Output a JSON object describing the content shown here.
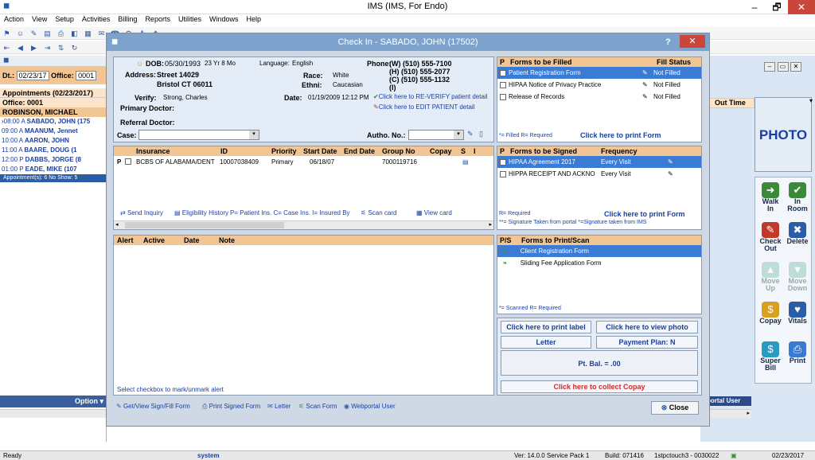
{
  "window": {
    "title": "IMS (IMS, For Endo)",
    "min": "–",
    "max": "🗗",
    "close": "✕"
  },
  "menu": [
    "Action",
    "View",
    "Setup",
    "Activities",
    "Billing",
    "Reports",
    "Utilities",
    "Windows",
    "Help"
  ],
  "left": {
    "dt_label": "Dt.:",
    "date": "02/23/17",
    "office_label": "Office:",
    "office_val": "0001",
    "header": "Appointments (02/23/2017)",
    "office": "Office: 0001",
    "patient": "ROBINSON, MICHAEL",
    "rows": [
      {
        "time": "08:00 A",
        "name": "SABADO, JOHN (175"
      },
      {
        "time": "09:00 A",
        "name": "MAANUM, Jennet"
      },
      {
        "time": "10:00 A",
        "name": "AARON, JOHN"
      },
      {
        "time": "11:00 A",
        "name": "BAARE, DOUG (1"
      },
      {
        "time": "12:00 P",
        "name": "DABBS, JORGE (8"
      },
      {
        "time": "01:00 P",
        "name": "EADE, MIKE (107"
      }
    ],
    "summary": "Appointment(s): 6   No Show: 5",
    "option": "Option"
  },
  "right": {
    "col1": "e",
    "col2": "Out Time",
    "photo": "PHOTO",
    "bottom": "portal User",
    "buttons": [
      {
        "label1": "Walk",
        "label2": "In",
        "icon": "walk-in-icon",
        "color": "#3a8a3a",
        "glyph": "➜",
        "dis": false
      },
      {
        "label1": "In",
        "label2": "Room",
        "icon": "in-room-icon",
        "color": "#3a8a3a",
        "glyph": "✔",
        "dis": false
      },
      {
        "label1": "Check",
        "label2": "Out",
        "icon": "check-out-icon",
        "color": "#c03a2a",
        "glyph": "✎",
        "dis": false
      },
      {
        "label1": "Delete",
        "label2": "",
        "icon": "delete-icon",
        "color": "#2a5ca8",
        "glyph": "✖",
        "dis": false
      },
      {
        "label1": "Move",
        "label2": "Up",
        "icon": "move-up-icon",
        "color": "#7fc0b0",
        "glyph": "▲",
        "dis": true
      },
      {
        "label1": "Move",
        "label2": "Down",
        "icon": "move-down-icon",
        "color": "#7fc0b0",
        "glyph": "▼",
        "dis": true
      },
      {
        "label1": "Copay",
        "label2": "",
        "icon": "copay-icon",
        "color": "#d8a020",
        "glyph": "$",
        "dis": false
      },
      {
        "label1": "Vitals",
        "label2": "",
        "icon": "vitals-icon",
        "color": "#2a5ca8",
        "glyph": "♥",
        "dis": false
      },
      {
        "label1": "Super",
        "label2": "Bill",
        "icon": "super-bill-icon",
        "color": "#2a9ac0",
        "glyph": "$",
        "dis": false
      },
      {
        "label1": "Print",
        "label2": "",
        "icon": "print-icon",
        "color": "#3a7ad5",
        "glyph": "⎙",
        "dis": false
      }
    ]
  },
  "dialog": {
    "title": "Check In - SABADO, JOHN  (17502)",
    "help": "?",
    "close": "✕",
    "dob_label": "DOB:",
    "dob": "05/30/1993",
    "age": "23 Yr 8 Mo",
    "lang_label": "Language:",
    "lang": "English",
    "phone_label": "Phone:",
    "phones": [
      "(W)  (510) 555-7100",
      "(H)  (510) 555-2077",
      "(C)  (510) 555-1132",
      "(I)"
    ],
    "addr_label": "Address:",
    "addr1": "Street 14029",
    "addr2": "Bristol  CT  06011",
    "race_label": "Race:",
    "race": "White",
    "eth_label": "Ethni:",
    "eth": "Caucasian",
    "verify_label": "Verify:",
    "verify": "Strong, Charles",
    "date_label": "Date:",
    "date": "01/19/2009 12:12 PM",
    "reverify": "Click here to RE-VERIFY patient detail",
    "edit": "Click here to EDIT PATIENT detail",
    "primary_doc": "Primary Doctor:",
    "referral_doc": "Referral Doctor:",
    "case": "Case:",
    "autho": "Autho. No.:",
    "ins_headers": [
      "Insurance",
      "ID",
      "Priority",
      "Start Date",
      "End Date",
      "Group No",
      "Copay",
      "S",
      "I"
    ],
    "ins_row": {
      "p": "P",
      "ins": "BCBS OF ALABAMA/DENT",
      "id": "10007038409",
      "priority": "Primary",
      "start": "06/18/07",
      "end": "",
      "group": "7000119716"
    },
    "ins_links": [
      "Send Inquiry",
      "Eligibility History",
      "P= Patient Ins. C= Case Ins. I= Insured By",
      "Scan card",
      "View card"
    ],
    "alert_headers": [
      "Alert",
      "Active",
      "Date",
      "Note"
    ],
    "alert_hint": "Select checkbox to mark/unmark alert",
    "fill": {
      "h1": "P",
      "h2": "Forms to be Filled",
      "h3": "Fill Status",
      "rows": [
        {
          "name": "Patient Registration Form",
          "status": "Not Filled"
        },
        {
          "name": "HIPAA Notice of Privacy Practice",
          "status": "Not Filled"
        },
        {
          "name": "Release of Records",
          "status": "Not Filled"
        }
      ],
      "legend": "*= Filled   R= Required",
      "print": "Click here to print Form"
    },
    "sign": {
      "h1": "P",
      "h2": "Forms to be Signed",
      "h3": "Frequency",
      "rows": [
        {
          "name": "HIPAA Agreement 2017",
          "freq": "Every Visit"
        },
        {
          "name": "HIPPA RECEIPT AND ACKNO",
          "freq": "Every Visit"
        }
      ],
      "legend1": "R= Required",
      "legend2": "**= Signature Taken from portal  *=Signature taken from IMS",
      "print": "Click here to print Form"
    },
    "scan": {
      "h1": "P/S",
      "h2": "Forms to Print/Scan",
      "rows": [
        "Client Registration Form",
        "Sliding Fee Application Form"
      ],
      "legend": "*= Scanned   R= Required"
    },
    "btns": {
      "print_label": "Click here to print label",
      "view_photo": "Click here to view photo",
      "letter": "Letter",
      "payment": "Payment Plan: N",
      "bal": "Pt. Bal. = .00",
      "collect": "Click here to collect Copay"
    },
    "bottom": [
      "Get/View Sign/Fill Form",
      "Print Signed Form",
      "Letter",
      "Scan Form",
      "Webportal User"
    ],
    "close_btn": "Close"
  },
  "status": {
    "ready": "Ready",
    "user": "system",
    "ver": "Ver: 14.0.0 Service Pack 1",
    "build": "Build: 071416",
    "host": "1stpctouch3 - 0030022",
    "date": "02/23/2017"
  }
}
